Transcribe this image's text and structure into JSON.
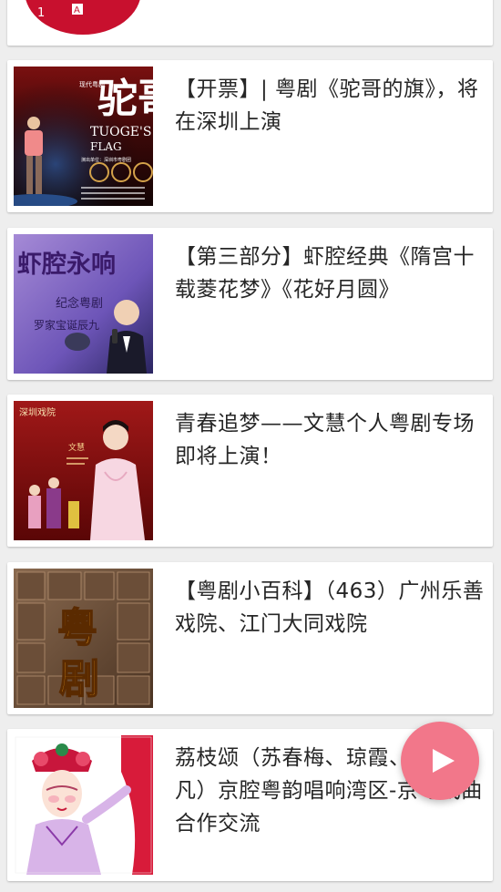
{
  "top_card": {
    "thumb_text": "1"
  },
  "articles": [
    {
      "title": "【开票】| 粤剧《驼哥的旗》，将在深圳上演",
      "thumb_icon": "opera-poster-tuoge",
      "thumb_text_1": "驼哥",
      "thumb_text_2": "TUOGE'S",
      "thumb_text_3": "FLAG",
      "thumb_text_4": "现代粤剧",
      "thumb_text_5": "演出单位：深圳市粤剧团"
    },
    {
      "title": "【第三部分】虾腔经典《隋宫十载菱花梦》《花好月圆》",
      "thumb_icon": "opera-singer-stage",
      "thumb_text_1": "虾腔永响",
      "thumb_text_2": "纪念粤剧",
      "thumb_text_3": "罗家宝诞辰九"
    },
    {
      "title": "青春追梦——文慧个人粤剧专场即将上演！",
      "thumb_icon": "opera-performer-poster",
      "thumb_text_1": "深圳戏院",
      "thumb_text_2": "文慧"
    },
    {
      "title": "【粤剧小百科】（463）广州乐善戏院、江门大同戏院",
      "thumb_icon": "cantonese-opera-relief",
      "thumb_text_1": "粤",
      "thumb_text_2": "剧"
    },
    {
      "title": "荔枝颂（苏春梅、琼霞、梁兆凡）京腔粤韵唱响湾区-京粤戏曲合作交流",
      "thumb_icon": "opera-actress-costume"
    }
  ],
  "fab": {
    "icon": "play-icon",
    "color": "#f2778a"
  }
}
